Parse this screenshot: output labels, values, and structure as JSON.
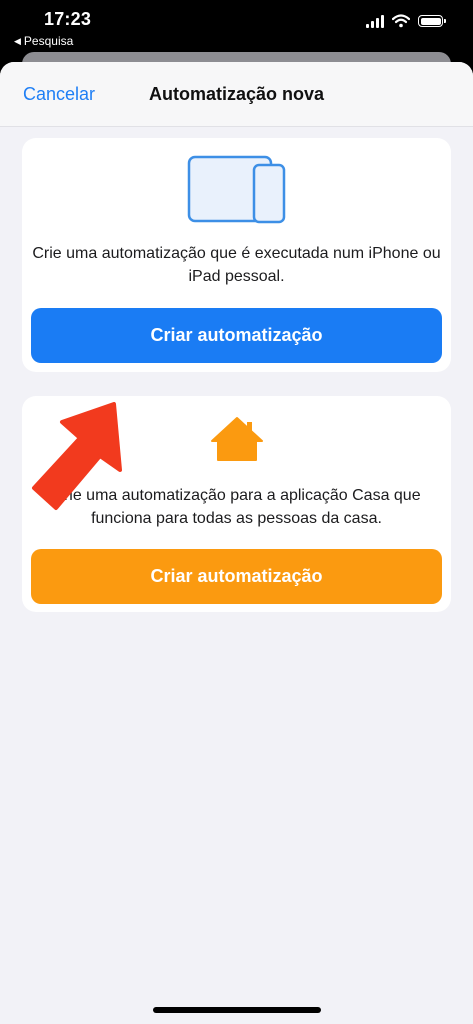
{
  "status_bar": {
    "time": "17:23",
    "back_label": "Pesquisa",
    "icons": [
      "cellular-signal-icon",
      "wifi-icon",
      "battery-icon"
    ]
  },
  "nav": {
    "cancel_label": "Cancelar",
    "title": "Automatização nova"
  },
  "cards": {
    "personal": {
      "icon": "ipad-iphone-icon",
      "description": "Crie uma automatização que é executada num iPhone ou iPad pessoal.",
      "button_label": "Criar automatização",
      "button_color": "#1a7cf4"
    },
    "home": {
      "icon": "house-icon",
      "description": "Crie uma automatização para a aplicação Casa que funciona para todas as pessoas da casa.",
      "button_label": "Criar automatização",
      "button_color": "#fb9a10"
    }
  },
  "annotation": {
    "icon": "red-arrow-icon",
    "color": "#f23a1e"
  },
  "colors": {
    "accent": "#1f7ff5",
    "background": "#f2f2f7"
  }
}
